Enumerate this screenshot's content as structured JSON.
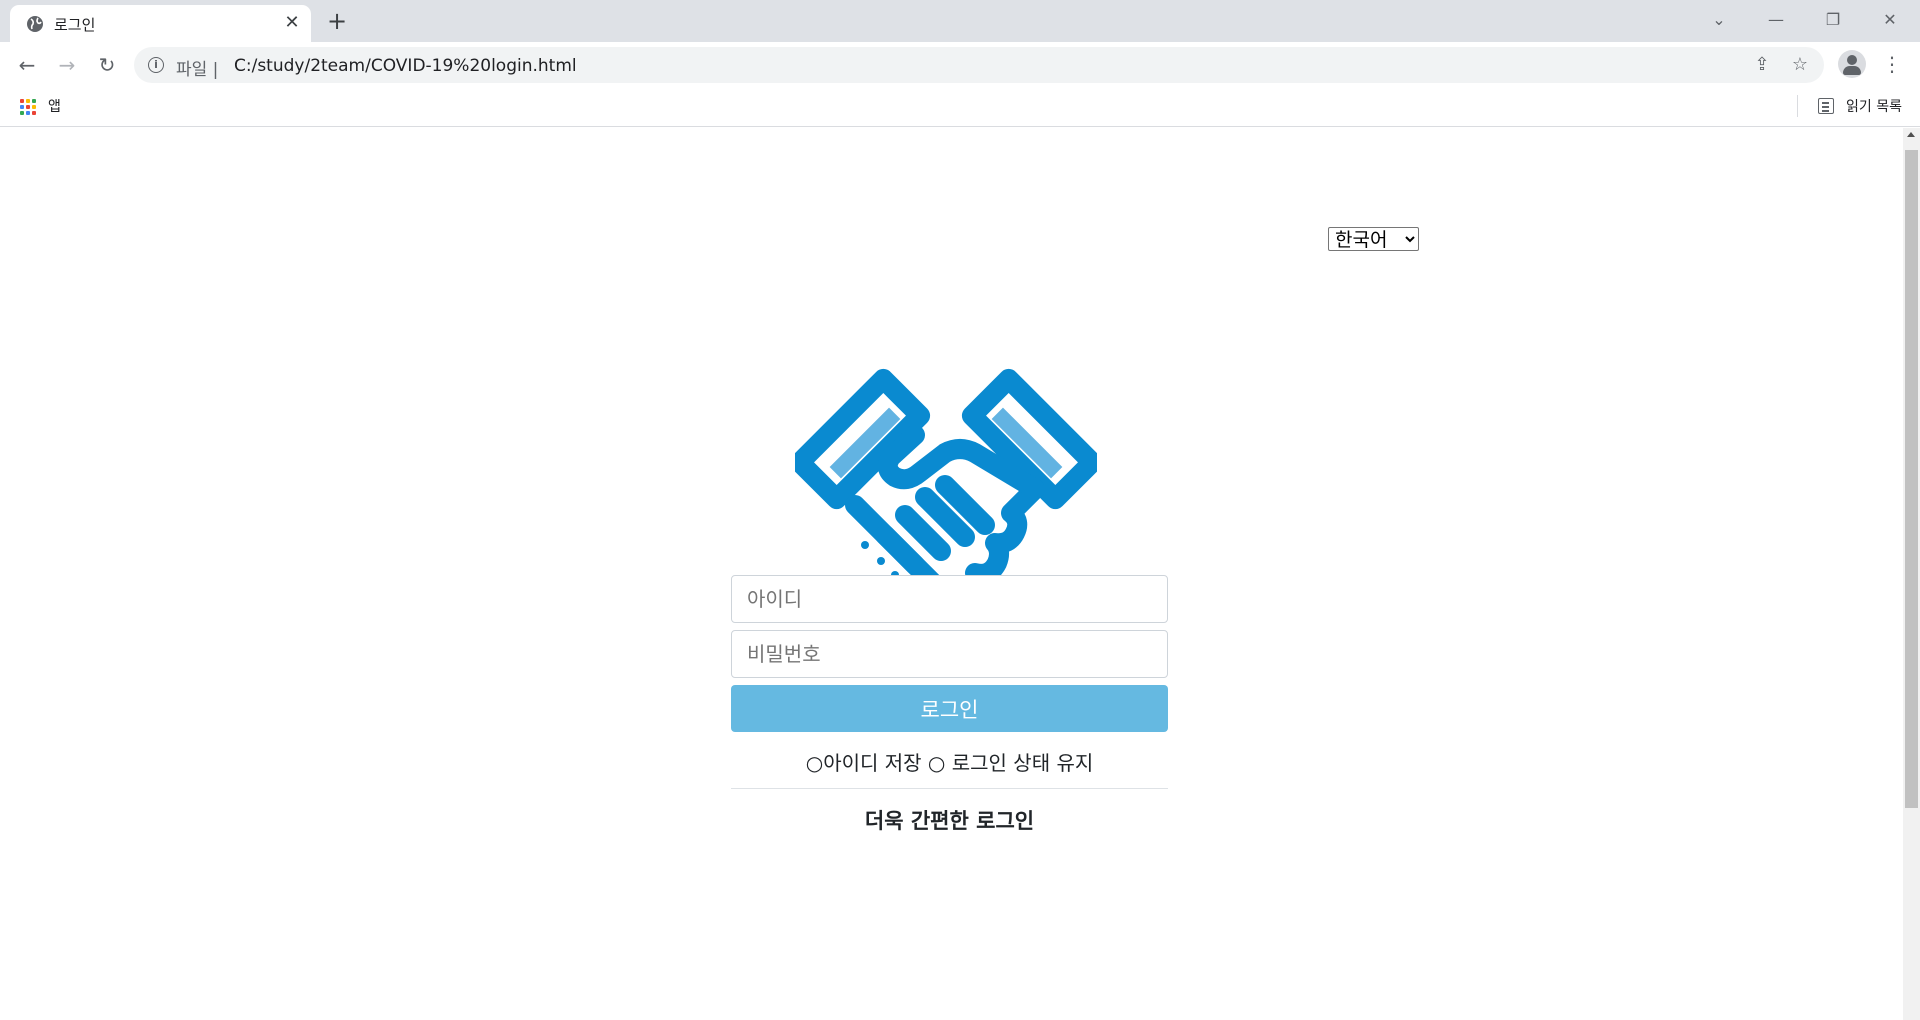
{
  "browser": {
    "tab_title": "로그인",
    "new_tab": "+",
    "url_scheme": "파일 |",
    "url": "C:/study/2team/COVID-19%20login.html",
    "apps_label": "앱",
    "reading_list": "읽기 목록"
  },
  "page": {
    "language_options": [
      "한국어"
    ],
    "language_selected": "한국어",
    "logo_icon": "handshake-icon",
    "logo_color": "#0a8ad0",
    "id_placeholder": "아이디",
    "password_placeholder": "비밀번호",
    "login_button": "로그인",
    "save_id_label": "○아이디 저장",
    "keep_login_label": "○ 로그인 상태 유지",
    "easy_login_title": "더욱 간편한 로그인",
    "button_color": "#65b9e1"
  }
}
